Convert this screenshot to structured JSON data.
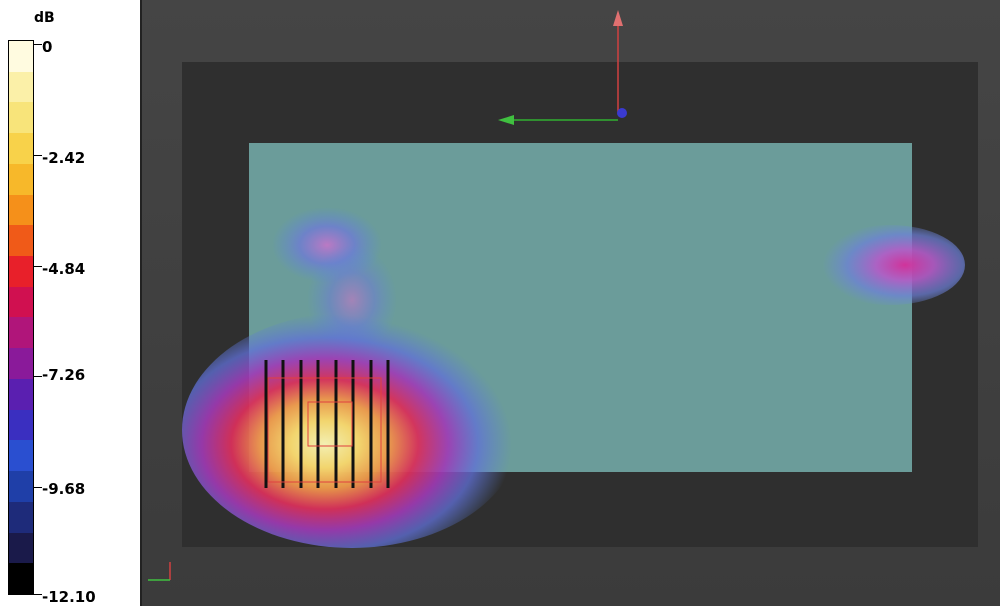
{
  "legend": {
    "unit": "dB",
    "ticks": [
      "0",
      "-2.42",
      "-4.84",
      "-7.26",
      "-9.68",
      "-12.10"
    ],
    "colors": [
      "#000000",
      "#1a1a4a",
      "#1e2b7a",
      "#1f3fa8",
      "#2a4fd0",
      "#3a2fc0",
      "#5a1fb0",
      "#8a1a9a",
      "#b0157a",
      "#d01050",
      "#e8202a",
      "#f05a18",
      "#f5901a",
      "#f7b82a",
      "#f8d24a",
      "#f8e47a",
      "#fbf0a8",
      "#fffbe0"
    ]
  },
  "viewport": {
    "background": "#404040",
    "inner_panel_color": "#2e2e2e",
    "board_color": "#6e9e9c"
  }
}
